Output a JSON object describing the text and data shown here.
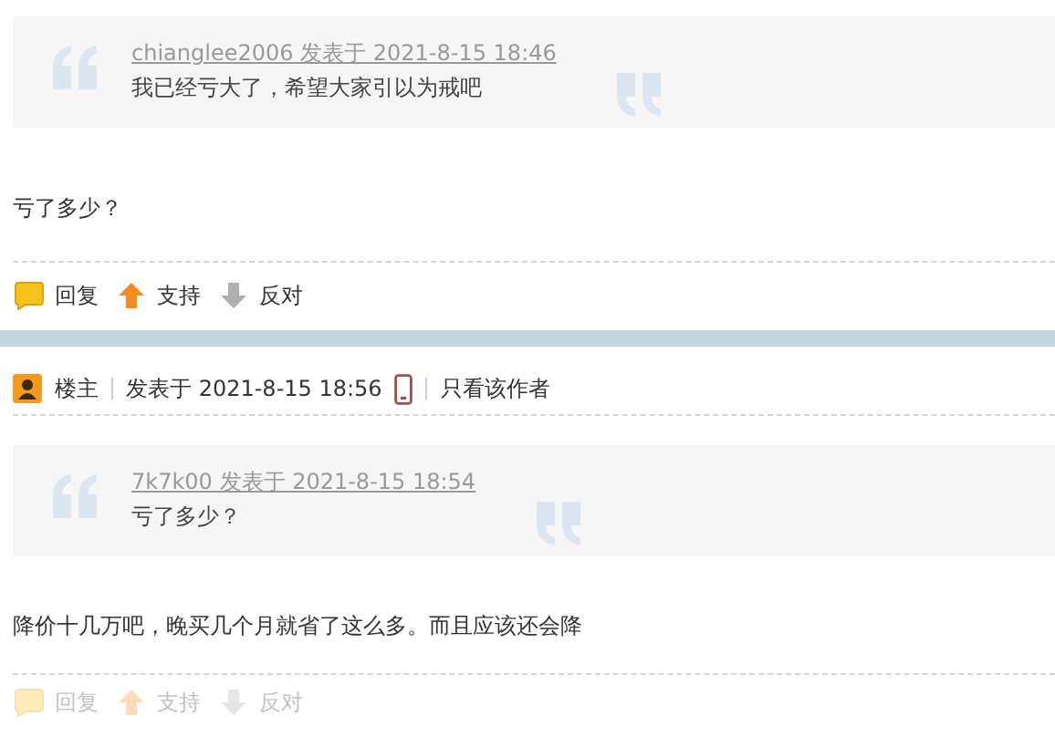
{
  "posts": [
    {
      "quote": {
        "byline": "chianglee2006 发表于 2021-8-15 18:46",
        "text": "我已经亏大了，希望大家引以为戒吧"
      },
      "body": "亏了多少？",
      "dimmed": false,
      "actions": [
        {
          "kind": "reply",
          "label": "回复"
        },
        {
          "kind": "support",
          "label": "支持"
        },
        {
          "kind": "oppose",
          "label": "反对"
        }
      ]
    },
    {
      "header": {
        "role": "楼主",
        "posted": "发表于 2021-8-15 18:56",
        "mobile": true,
        "link": "只看该作者"
      },
      "quote": {
        "byline": "7k7k00 发表于 2021-8-15 18:54",
        "text": "亏了多少？"
      },
      "body": "降价十几万吧，晚买几个月就省了这么多。而且应该还会降",
      "dimmed": true,
      "actions": [
        {
          "kind": "reply",
          "label": "回复"
        },
        {
          "kind": "support",
          "label": "支持"
        },
        {
          "kind": "oppose",
          "label": "反对"
        }
      ]
    }
  ]
}
